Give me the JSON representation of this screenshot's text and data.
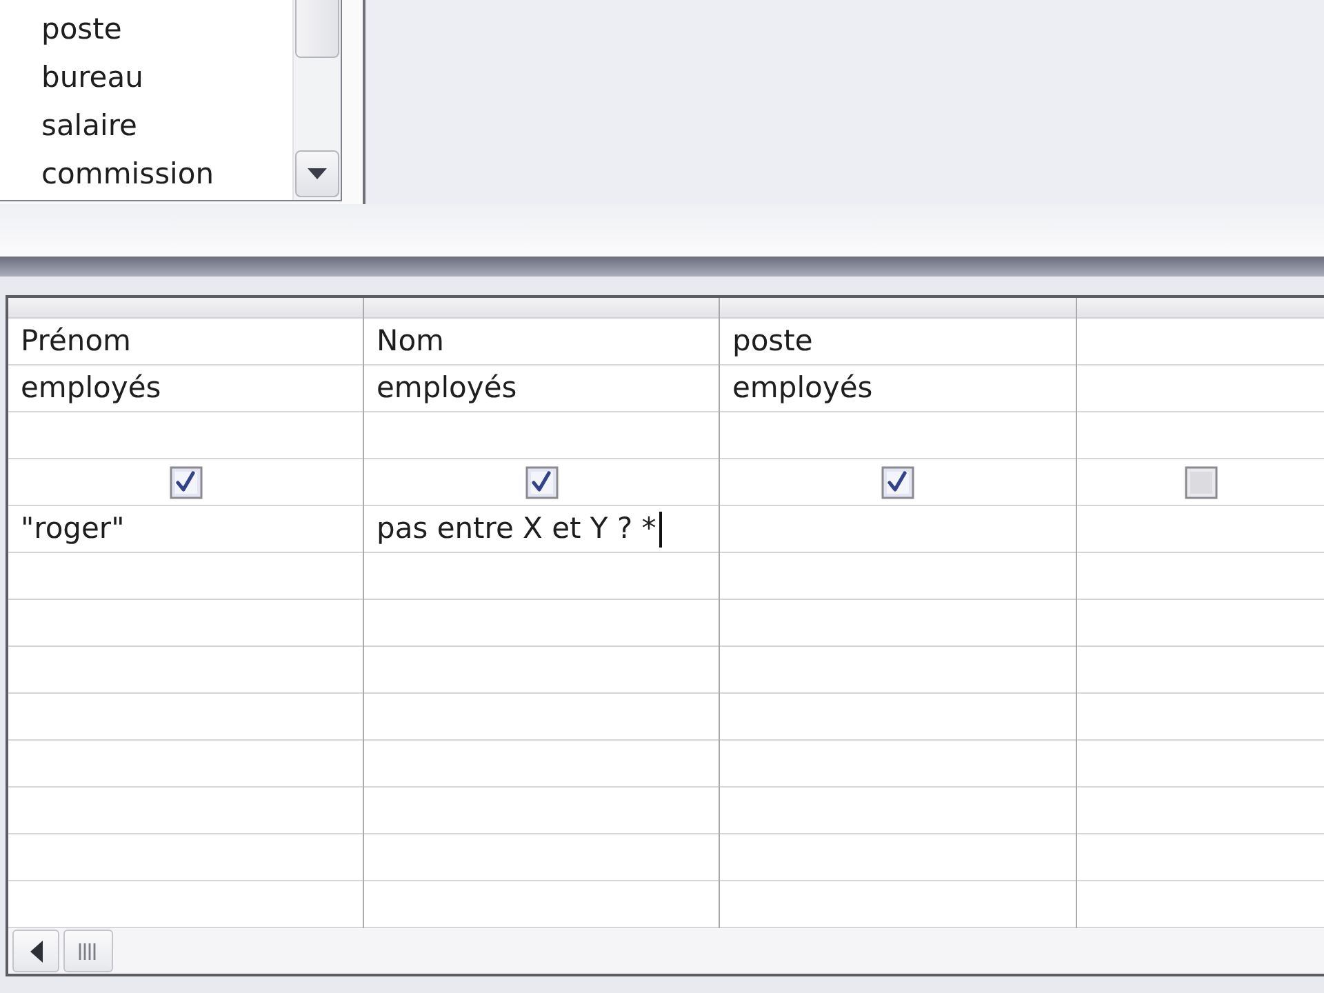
{
  "field_list": {
    "items": [
      "poste",
      "bureau",
      "salaire",
      "commission"
    ]
  },
  "design_grid": {
    "columns": [
      {
        "field": "Prénom",
        "table": "employés",
        "show": true,
        "criteria": "\"roger\"",
        "caret": false
      },
      {
        "field": "Nom",
        "table": "employés",
        "show": true,
        "criteria": "pas entre X et Y ? *",
        "caret": true
      },
      {
        "field": "poste",
        "table": "employés",
        "show": true,
        "caret": false
      },
      {
        "show": false,
        "caret": false
      }
    ]
  }
}
